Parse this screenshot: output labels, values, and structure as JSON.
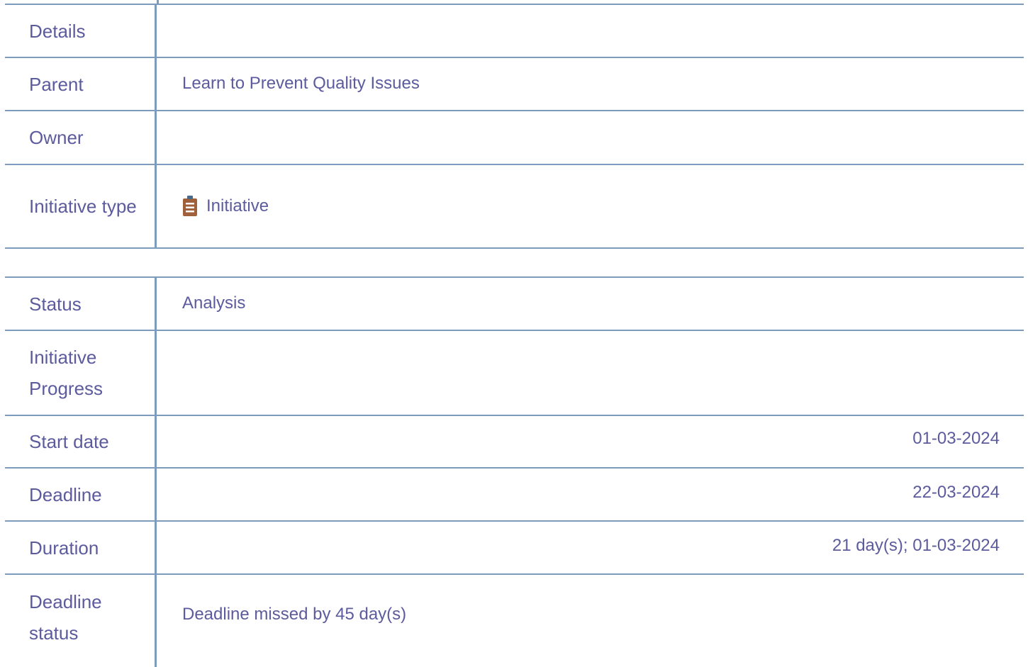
{
  "section1": {
    "rows": [
      {
        "label": "Details",
        "value": ""
      },
      {
        "label": "Parent",
        "value": "Learn to Prevent Quality Issues"
      },
      {
        "label": "Owner",
        "value": ""
      },
      {
        "label": "Initiative type",
        "value": "Initiative",
        "icon": "clipboard-icon"
      }
    ]
  },
  "section2": {
    "rows": [
      {
        "label": "Status",
        "value": "Analysis"
      },
      {
        "label": "Initiative Progress",
        "value": ""
      },
      {
        "label": "Start date",
        "value": "01-03-2024"
      },
      {
        "label": "Deadline",
        "value": "22-03-2024"
      },
      {
        "label": "Duration",
        "value": "21 day(s); 01-03-2024"
      },
      {
        "label": "Deadline status",
        "value": "Deadline missed by 45 day(s)"
      }
    ]
  },
  "colors": {
    "text": "#5c5b9e",
    "border": "#7d9bbd",
    "icon": "#a0603a"
  }
}
